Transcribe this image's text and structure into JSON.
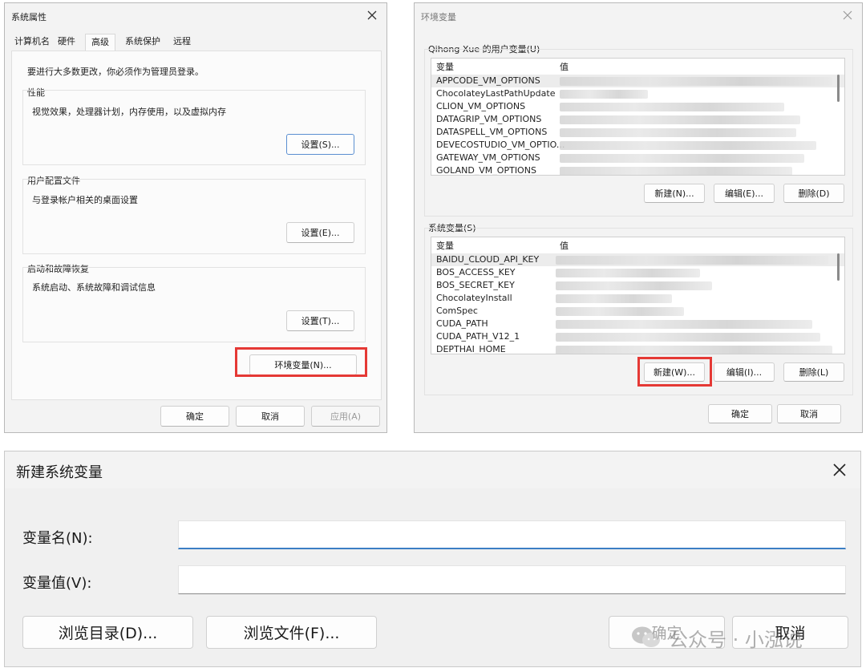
{
  "sysprops": {
    "title": "系统属性",
    "tabs": [
      "计算机名",
      "硬件",
      "高级",
      "系统保护",
      "远程"
    ],
    "notice": "要进行大多数更改，你必须作为管理员登录。",
    "perf": {
      "label": "性能",
      "desc": "视觉效果，处理器计划，内存使用，以及虚拟内存",
      "button": "设置(S)..."
    },
    "profile": {
      "label": "用户配置文件",
      "desc": "与登录帐户相关的桌面设置",
      "button": "设置(E)..."
    },
    "startup": {
      "label": "启动和故障恢复",
      "desc": "系统启动、系统故障和调试信息",
      "button": "设置(T)..."
    },
    "env_button": "环境变量(N)...",
    "ok": "确定",
    "cancel": "取消",
    "apply": "应用(A)"
  },
  "envvars": {
    "title": "环境变量",
    "user_label": "Qihong Xue 的用户变量(U)",
    "col_var": "变量",
    "col_val": "值",
    "user_vars": [
      "APPCODE_VM_OPTIONS",
      "ChocolateyLastPathUpdate",
      "CLION_VM_OPTIONS",
      "DATAGRIP_VM_OPTIONS",
      "DATASPELL_VM_OPTIONS",
      "DEVECOSTUDIO_VM_OPTIO...",
      "GATEWAY_VM_OPTIONS",
      "GOLAND_VM_OPTIONS"
    ],
    "user_buttons": [
      "新建(N)...",
      "编辑(E)...",
      "删除(D)"
    ],
    "sys_label": "系统变量(S)",
    "sys_vars": [
      "BAIDU_CLOUD_API_KEY",
      "BOS_ACCESS_KEY",
      "BOS_SECRET_KEY",
      "ChocolateyInstall",
      "ComSpec",
      "CUDA_PATH",
      "CUDA_PATH_V12_1",
      "DEPTHAI_HOME"
    ],
    "sys_buttons": [
      "新建(W)...",
      "编辑(I)...",
      "删除(L)"
    ],
    "ok": "确定",
    "cancel": "取消"
  },
  "newvar": {
    "title": "新建系统变量",
    "name_label": "变量名(N):",
    "value_label": "变量值(V):",
    "browse_dir": "浏览目录(D)...",
    "browse_file": "浏览文件(F)...",
    "ok": "确定",
    "cancel": "取消"
  },
  "watermark": "公众号 · 小泓说"
}
